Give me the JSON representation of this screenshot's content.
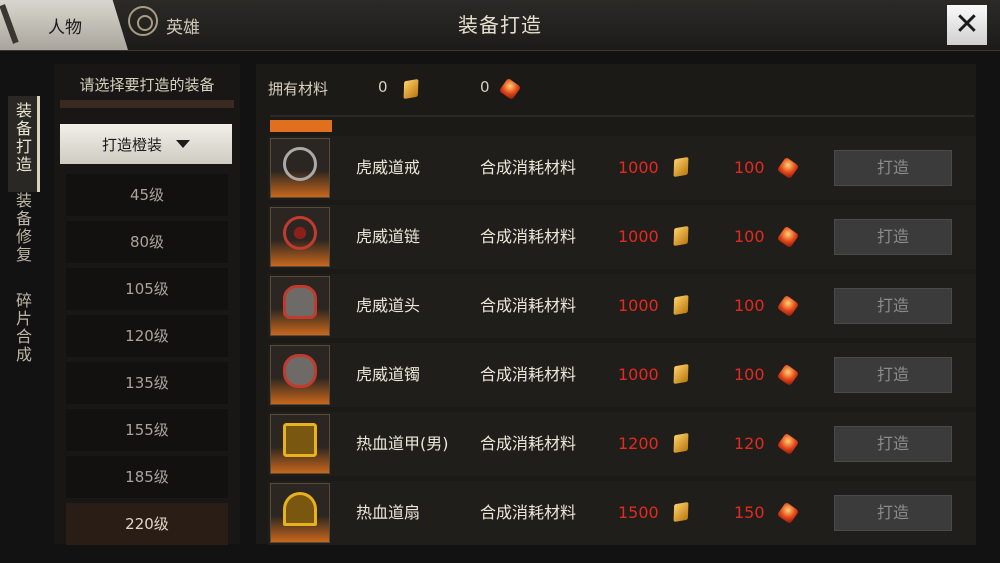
{
  "tabs": [
    {
      "label": "人物"
    },
    {
      "label": "英雄"
    }
  ],
  "title": "装备打造",
  "close_label": "✕",
  "sidenav": [
    "装备打造",
    "装备修复",
    "碎片合成"
  ],
  "left": {
    "title": "请选择要打造的装备",
    "dropdown": "打造橙装",
    "levels": [
      "45级",
      "80级",
      "105级",
      "120级",
      "135级",
      "155级",
      "185级",
      "220级"
    ]
  },
  "materials": {
    "label": "拥有材料",
    "count1": "0",
    "count2": "0"
  },
  "rows": [
    {
      "name": "虎威道戒",
      "cost": "合成消耗材料",
      "v1": "1000",
      "v2": "100",
      "btn": "打造"
    },
    {
      "name": "虎威道链",
      "cost": "合成消耗材料",
      "v1": "1000",
      "v2": "100",
      "btn": "打造"
    },
    {
      "name": "虎威道头",
      "cost": "合成消耗材料",
      "v1": "1000",
      "v2": "100",
      "btn": "打造"
    },
    {
      "name": "虎威道镯",
      "cost": "合成消耗材料",
      "v1": "1000",
      "v2": "100",
      "btn": "打造"
    },
    {
      "name": "热血道甲(男)",
      "cost": "合成消耗材料",
      "v1": "1200",
      "v2": "120",
      "btn": "打造"
    },
    {
      "name": "热血道扇",
      "cost": "合成消耗材料",
      "v1": "1500",
      "v2": "150",
      "btn": "打造"
    }
  ],
  "colors": {
    "accent_orange": "#e0701e",
    "cost_red": "#e32a1f"
  }
}
